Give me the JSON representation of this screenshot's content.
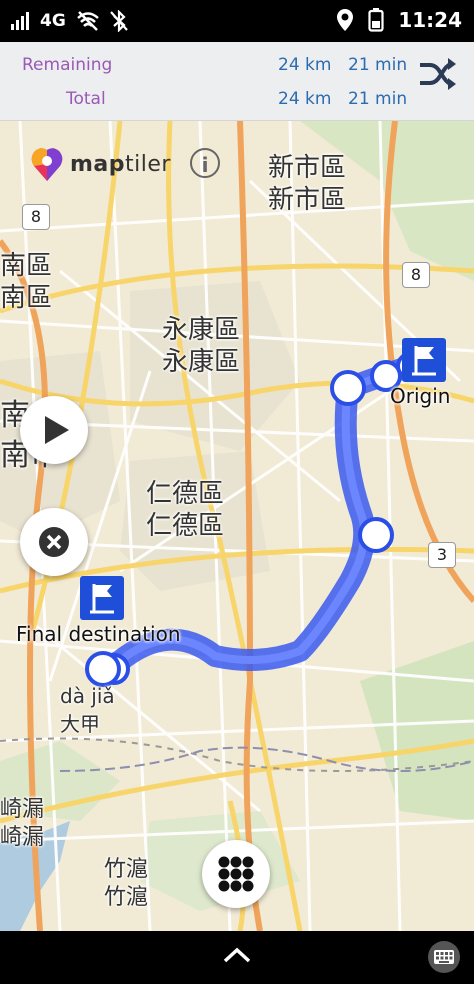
{
  "status_bar": {
    "network": "4G",
    "time": "11:24",
    "icons": [
      "signal-icon",
      "wifi-off-icon",
      "bluetooth-off-icon",
      "location-icon",
      "battery-icon"
    ]
  },
  "route_summary": {
    "remaining_label": "Remaining",
    "remaining_distance": "24 km",
    "remaining_time": "21 min",
    "total_label": "Total",
    "total_distance": "24 km",
    "total_time": "21 min"
  },
  "map": {
    "logo": {
      "prefix": "map",
      "suffix": "tiler"
    },
    "info_icon": "i",
    "places": [
      {
        "id": "xinshi",
        "text1": "新市區",
        "text2": "新市區"
      },
      {
        "id": "nan1",
        "text1": "南區",
        "text2": "南區"
      },
      {
        "id": "yongkang",
        "text1": "永康區",
        "text2": "永康區"
      },
      {
        "id": "nanshi",
        "text1": "南",
        "text2": "南市"
      },
      {
        "id": "rende",
        "text1": "仁德區",
        "text2": "仁德區"
      },
      {
        "id": "daja",
        "text1": "dà jiǎ",
        "text2": "大甲"
      },
      {
        "id": "qilou",
        "text1": "崎漏",
        "text2": "崎漏"
      },
      {
        "id": "zhulou",
        "text1": "竹滬",
        "text2": "竹滬"
      }
    ],
    "route_badges": {
      "b8a": "8",
      "b8b": "8",
      "b3": "3"
    },
    "origin_label": "Origin",
    "destination_label": "Final destination"
  },
  "colors": {
    "route": "#3b5bf0",
    "marker": "#1f4fd8",
    "remaining_label": "#9b59b6",
    "values": "#2b6cb0",
    "map_bg": "#f1ead5"
  }
}
